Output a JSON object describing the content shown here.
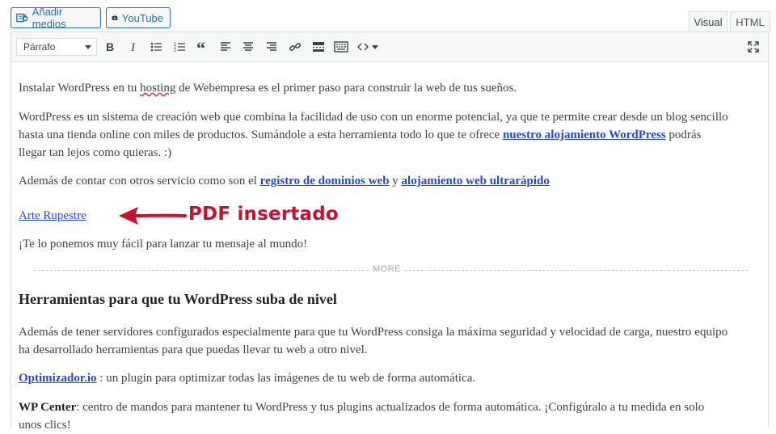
{
  "media_buttons": {
    "add_media_label": "Añadir medios",
    "youtube_label": "YouTube"
  },
  "tabs": {
    "visual": "Visual",
    "html": "HTML"
  },
  "toolbar": {
    "format_value": "Párrafo",
    "icons": [
      "bold-icon",
      "italic-icon",
      "bullet-list-icon",
      "numbered-list-icon",
      "blockquote-icon",
      "align-left-icon",
      "align-center-icon",
      "align-right-icon",
      "link-icon",
      "read-more-icon",
      "toolbar-toggle-icon",
      "code-icon",
      "dropdown-icon",
      "fullscreen-icon"
    ]
  },
  "content": {
    "p1_a": "Instalar WordPress en tu ",
    "p1_b": "hosting",
    "p1_c": " de Webempresa es el primer paso para construir la web de tus sueños.",
    "p2_line1": "WordPress es un sistema de creación web que combina la facilidad de uso con un enorme potencial, ya que te permite crear desde un blog sencillo",
    "p2_line2_a": "hasta una tienda online con miles de productos. Sumándole a esta herramienta todo lo que te ofrece ",
    "p2_line2_link": "nuestro alojamiento WordPress",
    "p2_line2_b": " podrás",
    "p2_line3": "llegar tan lejos como quieras. :)",
    "p3_a": "Además de contar con otros servicio como son el ",
    "p3_link1": "registro de dominios web",
    "p3_b": " y ",
    "p3_link2": "alojamiento web ultrarápido",
    "pdf_link": "Arte Rupestre",
    "p4": "¡Te lo ponemos muy fácil para lanzar tu mensaje al mundo!",
    "more_label": "MORE",
    "heading": "Herramientas para que tu WordPress suba de nivel",
    "p5_line1": "Además de tener servidores configurados especialmente para que tu WordPress consiga la máxima seguridad y velocidad de carga, nuestro equipo",
    "p5_line2": "ha desarrollado herramientas para que puedas llevar tu web a otro nivel.",
    "p6_link": "Optimizador.io",
    "p6_text": " : un plugin para optimizar todas las imágenes de tu web de forma automática.",
    "p7_bold": "WP Center",
    "p7_text": ": centro de mandos para mantener tu WordPress y tus plugins actualizados de forma automática. ¡Configúralo a tu medida en solo",
    "p7_line2": "unos clics!"
  },
  "annotation": {
    "label": "PDF insertado",
    "color": "#c8102e"
  }
}
